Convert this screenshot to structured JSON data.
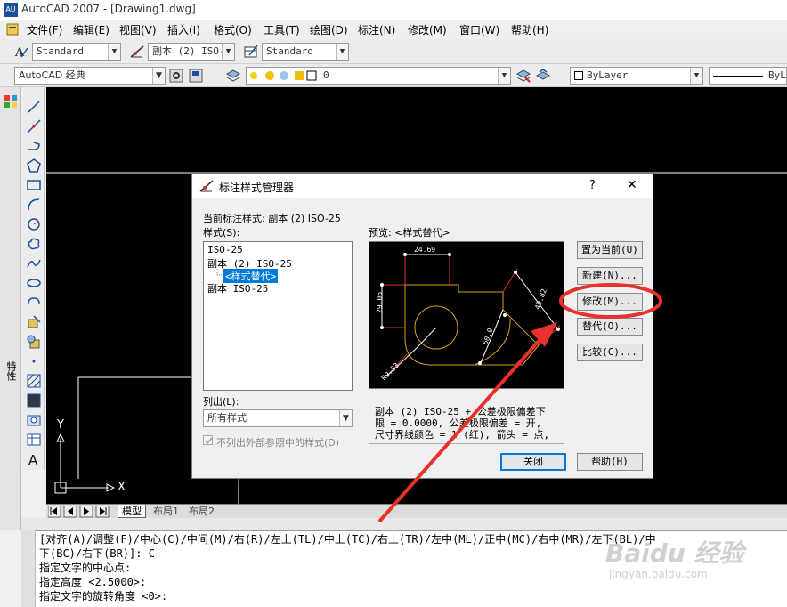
{
  "window": {
    "title": "AutoCAD 2007 - [Drawing1.dwg]",
    "logo_text": "AU"
  },
  "menu": [
    "文件(F)",
    "编辑(E)",
    "视图(V)",
    "插入(I)",
    "格式(O)",
    "工具(T)",
    "绘图(D)",
    "标注(N)",
    "修改(M)",
    "窗口(W)",
    "帮助(H)"
  ],
  "toolbar1": {
    "text_style": "Standard",
    "dim_style": "副本 (2) ISO-",
    "table_style": "Standard"
  },
  "toolbar2": {
    "workspace": "AutoCAD 经典",
    "layer": "0",
    "color": "ByLayer",
    "linetype": "ByL"
  },
  "side_panel_label": "特性",
  "ucs": {
    "x": "X",
    "y": "Y"
  },
  "tabs": {
    "model": "模型",
    "layout1": "布局1",
    "layout2": "布局2"
  },
  "command_lines": [
    "[对齐(A)/调整(F)/中心(C)/中间(M)/右(R)/左上(TL)/中上(TC)/右上(TR)/左中(ML)/正中(MC)/右中(MR)/左下(BL)/中",
    "下(BC)/右下(BR)]: C",
    "指定文字的中心点:",
    "指定高度 <2.5000>:",
    "指定文字的旋转角度 <0>:"
  ],
  "dialog": {
    "title": "标注样式管理器",
    "help_glyph": "?",
    "close_glyph": "✕",
    "current_style_label": "当前标注样式: 副本 (2) ISO-25",
    "styles_label": "样式(S):",
    "styles": [
      "ISO-25",
      "副本 (2) ISO-25",
      "<样式替代>",
      "副本 ISO-25"
    ],
    "preview_label": "预览: <样式替代>",
    "list_label": "列出(L):",
    "list_value": "所有样式",
    "xref_checkbox_label": "不列出外部参照中的样式(D)",
    "description_label": "说明",
    "description_lines": [
      "副本 (2) ISO-25 + 公差极限偏差下",
      "限 = 0.0000, 公差极限偏差 = 开,",
      "尺寸界线颜色 = 1 (红), 箭头 = 点,"
    ],
    "buttons": {
      "set_current": "置为当前(U)",
      "new": "新建(N)...",
      "modify": "修改(M)...",
      "override": "替代(O)...",
      "compare": "比较(C)...",
      "close": "关闭",
      "help": "帮助(H)"
    },
    "preview_dims": {
      "top": "24.69",
      "left": "29.06",
      "right": "49.82",
      "diag": "R9.53",
      "small": "60.0"
    }
  },
  "watermark": {
    "brand": "Baidu 经验",
    "url": "jingyan.baidu.com"
  },
  "colors": {
    "annotation_red": "#e8302c",
    "canvas": "#000000",
    "selection": "#0078d7",
    "preview_yellow": "#d8a020"
  }
}
